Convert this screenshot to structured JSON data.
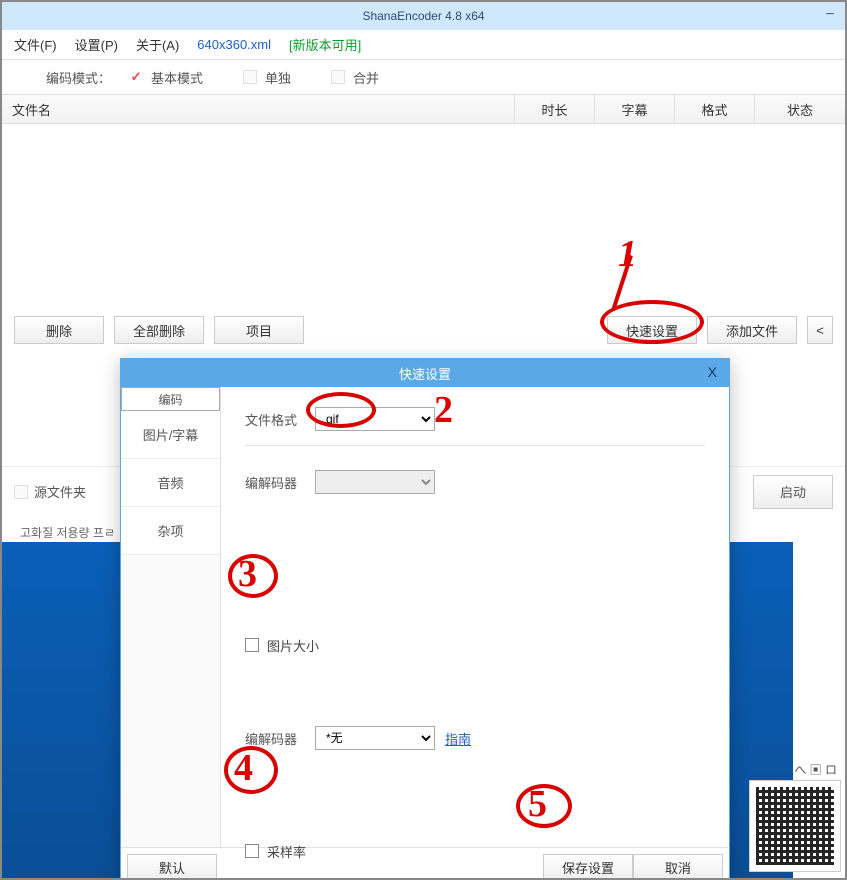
{
  "title": "ShanaEncoder 4.8 x64",
  "menus": {
    "file": "文件(F)",
    "settings": "设置(P)",
    "about": "关于(A)",
    "preset": "640x360.xml",
    "update": "[新版本可用]"
  },
  "moderow": {
    "label": "编码模式：",
    "basic": "基本模式",
    "single": "单独",
    "merge": "合并"
  },
  "cols": {
    "name": "文件名",
    "dur": "时长",
    "sub": "字幕",
    "fmt": "格式",
    "stat": "状态"
  },
  "buttons": {
    "delete": "删除",
    "deleteAll": "全部删除",
    "project": "项目",
    "quick": "快速设置",
    "addFile": "添加文件",
    "more": "<"
  },
  "lower": {
    "srcFolder": "源文件夹",
    "start": "启动"
  },
  "status": "고화질 저용량 프ㄹ",
  "dialog": {
    "title": "快速设置",
    "close": "X",
    "tabs": {
      "encode": "编码",
      "pic": "图片/字幕",
      "audio": "音频",
      "misc": "杂项"
    },
    "filefmt": {
      "label": "文件格式",
      "value": "gif"
    },
    "codec1": {
      "label": "编解码器"
    },
    "picsize": {
      "label": "图片大小"
    },
    "codec2": {
      "label": "编解码器",
      "value": "*无",
      "guide": "指南"
    },
    "sample": {
      "label": "采样率"
    },
    "btns": {
      "default": "默认",
      "save": "保存设置",
      "cancel": "取消"
    }
  },
  "annot": {
    "n1": "1",
    "n2": "2",
    "n3": "3",
    "n4": "4",
    "n5": "5"
  },
  "tray": "へ ▣  ロ"
}
